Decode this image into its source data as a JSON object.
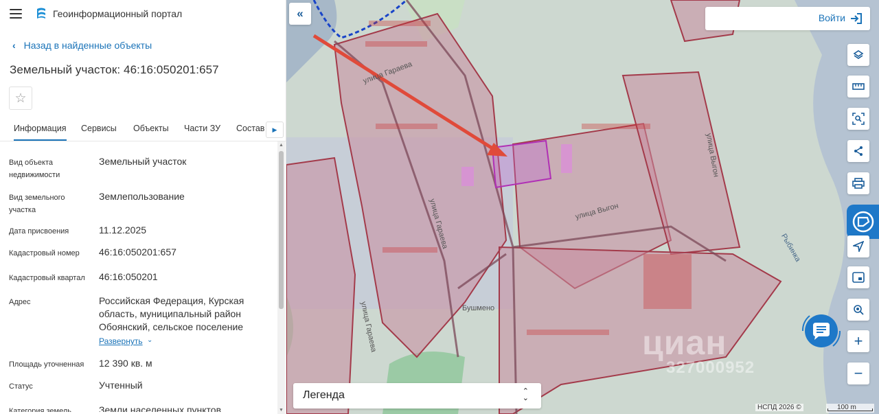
{
  "header": {
    "title": "Геоинформационный портал"
  },
  "nav": {
    "back_label": "Назад в найденные объекты"
  },
  "object": {
    "title": "Земельный участок: 46:16:050201:657"
  },
  "tabs": [
    {
      "label": "Информация",
      "active": true
    },
    {
      "label": "Сервисы"
    },
    {
      "label": "Объекты"
    },
    {
      "label": "Части ЗУ"
    },
    {
      "label": "Состав"
    }
  ],
  "properties": [
    {
      "label": "Вид объекта недвижимости",
      "value": "Земельный участок"
    },
    {
      "label": "Вид земельного участка",
      "value": "Землепользование"
    },
    {
      "label": "Дата присвоения",
      "value": "11.12.2025"
    },
    {
      "label": "Кадастровый номер",
      "value": "46:16:050201:657"
    },
    {
      "label": "Кадастровый квартал",
      "value": "46:16:050201"
    },
    {
      "label": "Адрес",
      "value": "Российская Федерация, Курская область, муниципальный район Обоянский, сельское поселение"
    },
    {
      "label": "Площадь уточненная",
      "value": "12 390 кв. м"
    },
    {
      "label": "Статус",
      "value": "Учтенный"
    },
    {
      "label": "Категория земель",
      "value": "Земли населенных пунктов"
    }
  ],
  "address_expand_label": "Развернуть",
  "map": {
    "login_label": "Войти",
    "legend_label": "Легенда",
    "attribution": "НСПД 2026 ©",
    "scale_label": "100 m",
    "labels": {
      "street_garaeva_1": "улица Гараева",
      "street_garaeva_2": "улица Гараева",
      "street_garaeva_3": "улица Гараева",
      "street_vygon_1": "улица Выгон",
      "street_vygon_2": "улица Выгон",
      "place_bushmeno": "Бушмено",
      "river": "Рыбинка"
    },
    "watermark": "циан",
    "watermark_id": "327000952"
  },
  "colors": {
    "accent": "#1a73b8",
    "parcel_fill": "#c98c9e",
    "parcel_stroke": "#a33a4a",
    "selected_parcel": "#b02fb5",
    "arrow": "#e04a3a",
    "water": "#b9c7d4"
  },
  "icons": {
    "menu": "menu-icon",
    "logo": "portal-logo-icon",
    "back": "chevron-left-icon",
    "favorite": "star-icon",
    "collapse": "double-chevron-left-icon",
    "login": "login-icon",
    "layers": "layers-icon",
    "ruler": "ruler-icon",
    "select": "area-select-icon",
    "share": "share-icon",
    "print": "print-icon",
    "nspd": "nspd-logo-icon",
    "locate": "navigation-arrow-icon",
    "minimap": "minimap-icon",
    "search_map": "map-search-icon",
    "zoom_in": "plus-icon",
    "zoom_out": "minus-icon",
    "chat": "chat-icon"
  }
}
